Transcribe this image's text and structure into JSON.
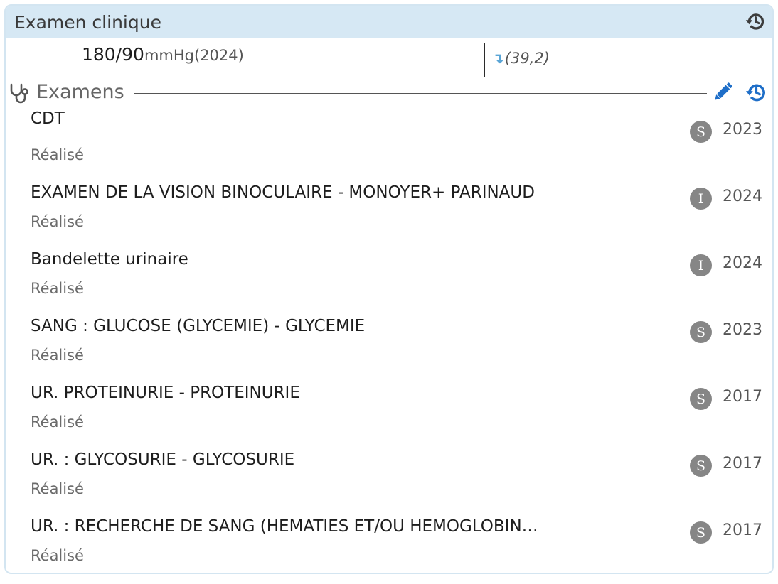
{
  "panel": {
    "title": "Examen clinique"
  },
  "vitals": {
    "bp_value": "180/90",
    "bp_unit": "mmHg",
    "bp_year": "(2024)",
    "trend_arrow": "↴",
    "trend_value": "(39,2)"
  },
  "section": {
    "title": "Examens"
  },
  "icons": {
    "header": "history-icon",
    "section_icon": "stethoscope-icon",
    "edit": "pencil-icon",
    "history": "history-icon"
  },
  "colors": {
    "header_bg": "#d6e8f4",
    "accent_blue": "#1e6ec8",
    "badge_grey": "#868686"
  },
  "exams": [
    {
      "name": "CDT",
      "status": "Réalisé",
      "badge": "S",
      "year": "2023"
    },
    {
      "name": "EXAMEN DE LA VISION BINOCULAIRE - MONOYER+ PARINAUD",
      "status": "Réalisé",
      "badge": "I",
      "year": "2024"
    },
    {
      "name": "Bandelette urinaire",
      "status": "Réalisé",
      "badge": "I",
      "year": "2024"
    },
    {
      "name": "SANG : GLUCOSE (GLYCEMIE) - GLYCEMIE",
      "status": "Réalisé",
      "badge": "S",
      "year": "2023"
    },
    {
      "name": "UR. PROTEINURIE - PROTEINURIE",
      "status": "Réalisé",
      "badge": "S",
      "year": "2017"
    },
    {
      "name": "UR. : GLYCOSURIE - GLYCOSURIE",
      "status": "Réalisé",
      "badge": "S",
      "year": "2017"
    },
    {
      "name": "UR. : RECHERCHE DE SANG (HEMATIES ET/OU HEMOGLOBIN…",
      "status": "Réalisé",
      "badge": "S",
      "year": "2017"
    }
  ]
}
